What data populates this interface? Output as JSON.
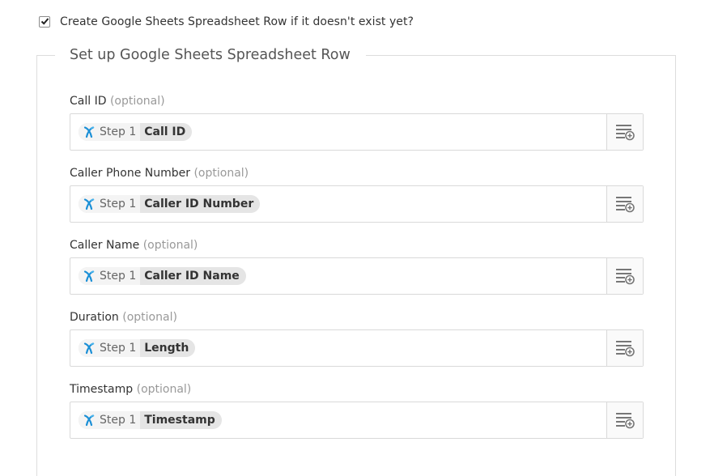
{
  "create_checkbox": {
    "checked": true,
    "label": "Create Google Sheets Spreadsheet Row if it doesn't exist yet?"
  },
  "section": {
    "legend": "Set up Google Sheets Spreadsheet Row"
  },
  "fields": [
    {
      "label": "Call ID",
      "optional": "(optional)",
      "step": "Step 1",
      "value": "Call ID"
    },
    {
      "label": "Caller Phone Number",
      "optional": "(optional)",
      "step": "Step 1",
      "value": "Caller ID Number"
    },
    {
      "label": "Caller Name",
      "optional": "(optional)",
      "step": "Step 1",
      "value": "Caller ID Name"
    },
    {
      "label": "Duration",
      "optional": "(optional)",
      "step": "Step 1",
      "value": "Length"
    },
    {
      "label": "Timestamp",
      "optional": "(optional)",
      "step": "Step 1",
      "value": "Timestamp"
    }
  ],
  "icons": {
    "app": "app-logo-icon",
    "insert": "insert-field-icon",
    "check": "checkmark-icon"
  },
  "colors": {
    "app_logo": "#1a8fd6",
    "pill_bg": "#e5e5e5",
    "border": "#d9d9d9"
  }
}
